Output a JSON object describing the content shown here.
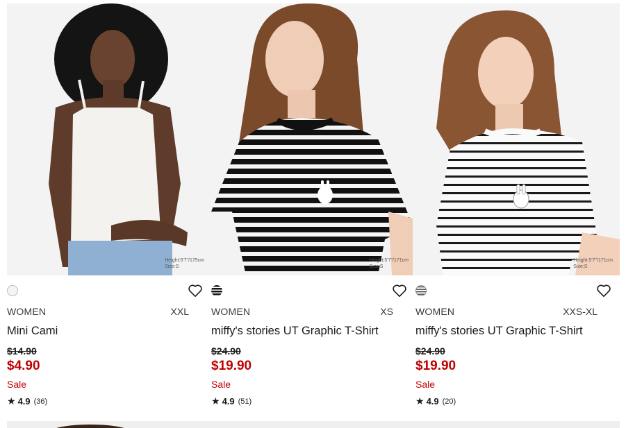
{
  "products": [
    {
      "gender": "WOMEN",
      "size": "XXL",
      "name": "Mini Cami",
      "original_price": "$14.90",
      "sale_price": "$4.90",
      "badge": "Sale",
      "rating": "4.9",
      "review_count": "(36)",
      "model_height": "Height:5'7\"/175cm",
      "model_size": "Size:S",
      "swatch_color": "#f4f4f4",
      "swatch_icon": "white-swatch"
    },
    {
      "gender": "WOMEN",
      "size": "XS",
      "name": "miffy's stories UT Graphic T-Shirt",
      "original_price": "$24.90",
      "sale_price": "$19.90",
      "badge": "Sale",
      "rating": "4.9",
      "review_count": "(51)",
      "model_height": "Height:5'7\"/171cm",
      "model_size": "Size:S",
      "swatch_color": "#111111",
      "swatch_icon": "black-stripe-swatch"
    },
    {
      "gender": "WOMEN",
      "size": "XXS-XL",
      "name": "miffy's stories UT Graphic T-Shirt",
      "original_price": "$24.90",
      "sale_price": "$19.90",
      "badge": "Sale",
      "rating": "4.9",
      "review_count": "(20)",
      "model_height": "Height:5'7\"/171cm",
      "model_size": "Size:S",
      "swatch_color": "#ffffff",
      "swatch_icon": "white-stripe-swatch"
    }
  ],
  "colors": {
    "sale_red": "#c00000",
    "text": "#1b1b1b"
  }
}
